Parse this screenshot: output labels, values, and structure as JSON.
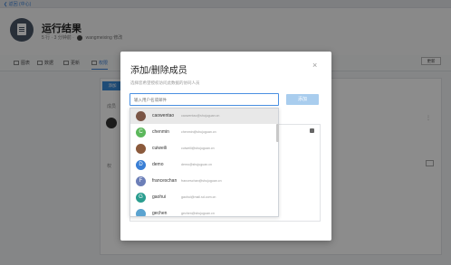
{
  "topbar": {
    "back_label": "❮ 返回 (中心)"
  },
  "header": {
    "title": "运行结果",
    "meta_prefix": "5 行 · 3 分钟前 ·",
    "meta_user": "wangmeixing 修改"
  },
  "tabs": [
    {
      "label": "图表"
    },
    {
      "label": "数据"
    },
    {
      "label": "更新"
    },
    {
      "label": "权限"
    }
  ],
  "right_button": "更新",
  "panel": {
    "blue_button": "添加",
    "header_text": "成员",
    "row_text": "权"
  },
  "modal": {
    "title": "添加/删除成员",
    "close": "×",
    "subtitle": "选择您希望授权访问此数据的协同人员",
    "search_placeholder": "输入用户名或邮件",
    "add_label": "添加"
  },
  "dropdown": [
    {
      "name": "caowentao",
      "email": "caowentao@shujuguan.cn",
      "color": "#7a5545",
      "initial": ""
    },
    {
      "name": "chenmin",
      "email": "chenmin@shujuguan.cn",
      "color": "#5cb85c",
      "initial": "C"
    },
    {
      "name": "cuiweili",
      "email": "cuiweili@shujuguan.cn",
      "color": "#8b5a3c",
      "initial": ""
    },
    {
      "name": "demo",
      "email": "demo@shujuguan.cn",
      "color": "#3a7fd5",
      "initial": "D"
    },
    {
      "name": "franceschan",
      "email": "franceschan@shujuguan.cn",
      "color": "#6c7fb8",
      "initial": "F"
    },
    {
      "name": "gaohui",
      "email": "gaohui@mail.sd.com.cn",
      "color": "#2a9d8f",
      "initial": "G"
    },
    {
      "name": "gechen",
      "email": "gechen@shujuguan.cn",
      "color": "#5ba3d0",
      "initial": ""
    }
  ]
}
